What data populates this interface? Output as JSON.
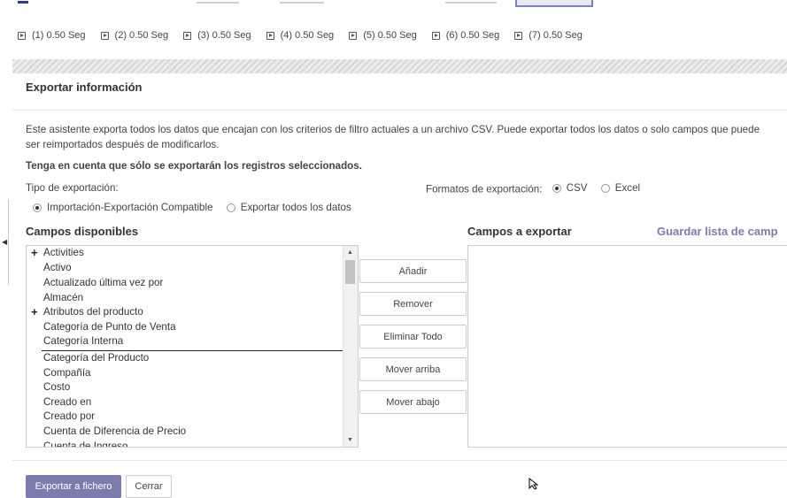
{
  "timings": [
    "(1) 0.50 Seg",
    "(2) 0.50 Seg",
    "(3) 0.50 Seg",
    "(4) 0.50 Seg",
    "(5) 0.50 Seg",
    "(6) 0.50 Seg",
    "(7) 0.50 Seg"
  ],
  "dialog": {
    "title": "Exportar información",
    "description_line1": "Este asistente exporta todos los datos que encajan con los criterios de filtro actuales a un archivo CSV. Puede exportar todos los datos o solo campos que puede",
    "description_line2": "ser reimportados después de modificarlos.",
    "note": "Tenga en cuenta que sólo se exportarán los registros seleccionados."
  },
  "export_type": {
    "label": "Tipo de exportación:",
    "options": [
      "Importación-Exportación Compatible",
      "Exportar todos los datos"
    ],
    "selected": "Importación-Exportación Compatible"
  },
  "export_format": {
    "label": "Formatos de exportación:",
    "options": [
      "CSV",
      "Excel"
    ],
    "selected": "CSV"
  },
  "available": {
    "title": "Campos disponibles",
    "items": [
      {
        "label": "Activities",
        "expandable": true
      },
      {
        "label": "Activo",
        "expandable": false
      },
      {
        "label": "Actualizado última vez por",
        "expandable": false
      },
      {
        "label": "Almacén",
        "expandable": false
      },
      {
        "label": "Atributos del producto",
        "expandable": true
      },
      {
        "label": "Categoría de Punto de Venta",
        "expandable": false
      },
      {
        "label": "Categoría Interna",
        "expandable": false
      },
      {
        "label": "Categoría del Producto",
        "expandable": false
      },
      {
        "label": "Compañía",
        "expandable": false
      },
      {
        "label": "Costo",
        "expandable": false
      },
      {
        "label": "Creado en",
        "expandable": false
      },
      {
        "label": "Creado por",
        "expandable": false
      },
      {
        "label": "Cuenta de Diferencia de Precio",
        "expandable": false
      },
      {
        "label": "Cuenta de Ingreso",
        "expandable": false
      }
    ]
  },
  "selected_fields": {
    "title": "Campos a exportar",
    "save_list": "Guardar lista de camp"
  },
  "actions": {
    "add": "Añadir",
    "remove": "Remover",
    "remove_all": "Eliminar Todo",
    "move_up": "Mover arriba",
    "move_down": "Mover abajo"
  },
  "footer": {
    "export": "Exportar a fichero",
    "close": "Cerrar"
  },
  "colors": {
    "accent": "#7c7bad"
  }
}
